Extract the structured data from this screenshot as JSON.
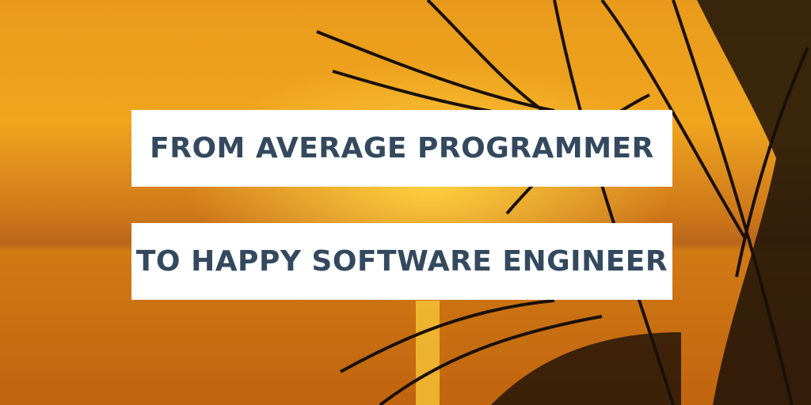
{
  "headline": {
    "line1": "FROM AVERAGE PROGRAMMER",
    "line2": "TO HAPPY SOFTWARE ENGINEER"
  },
  "colors": {
    "text": "#34495e",
    "box": "#ffffff",
    "sky": "#e8900e",
    "sea": "#c86e10"
  }
}
